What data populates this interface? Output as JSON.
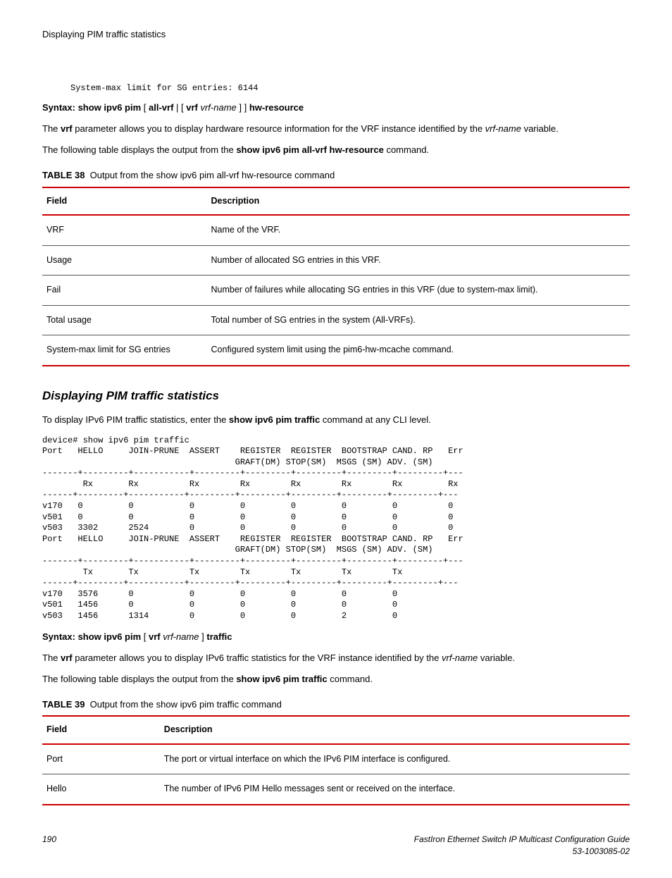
{
  "header": {
    "title": "Displaying PIM traffic statistics"
  },
  "codeblock1": "System-max limit for SG entries: 6144",
  "syntax1": {
    "prefix": "Syntax: show ipv6 pim",
    "open": " [ ",
    "allvrf": "all-vrf",
    "pipe": " | [ ",
    "vrf": "vrf",
    "vrfname": " vrf-name",
    "close": " ] ] ",
    "hw": "hw-resource"
  },
  "para1_a": "The ",
  "para1_b": "vrf",
  "para1_c": " parameter allows you to display hardware resource information for the VRF instance identified by the ",
  "para1_d": "vrf-name",
  "para1_e": " variable.",
  "para2_a": "The following table displays the output from the ",
  "para2_b": "show ipv6 pim all-vrf hw-resource",
  "para2_c": " command.",
  "table38": {
    "label": "TABLE 38",
    "title": "Output from the show ipv6 pim all-vrf hw-resource command",
    "h1": "Field",
    "h2": "Description",
    "rows": [
      {
        "f": "VRF",
        "d": "Name of the VRF."
      },
      {
        "f": "Usage",
        "d": "Number of allocated SG entries in this VRF."
      },
      {
        "f": "Fail",
        "d": "Number of failures while allocating SG entries in this VRF (due to system-max limit)."
      },
      {
        "f": "Total usage",
        "d": "Total number of SG entries in the system (All-VRFs)."
      },
      {
        "f": "System-max limit for SG entries",
        "d": "Configured system limit using the pim6-hw-mcache command."
      }
    ]
  },
  "section2": "Displaying PIM traffic statistics",
  "para3_a": "To display IPv6 PIM traffic statistics, enter the ",
  "para3_b": "show ipv6 pim traffic",
  "para3_c": " command at any CLI level.",
  "codeblock2": "device# show ipv6 pim traffic\nPort   HELLO     JOIN-PRUNE  ASSERT    REGISTER  REGISTER  BOOTSTRAP CAND. RP   Err\n                                      GRAFT(DM) STOP(SM)  MSGS (SM) ADV. (SM)\n-------+---------+-----------+---------+---------+---------+---------+---------+---\n        Rx       Rx          Rx        Rx        Rx        Rx        Rx         Rx\n------+---------+-----------+---------+---------+---------+---------+---------+---\nv170   0         0           0         0         0         0         0          0\nv501   0         0           0         0         0         0         0          0\nv503   3302      2524        0         0         0         0         0          0\nPort   HELLO     JOIN-PRUNE  ASSERT    REGISTER  REGISTER  BOOTSTRAP CAND. RP   Err\n                                      GRAFT(DM) STOP(SM)  MSGS (SM) ADV. (SM)\n-------+---------+-----------+---------+---------+---------+---------+---------+---\n        Tx       Tx          Tx        Tx        Tx        Tx        Tx\n------+---------+-----------+---------+---------+---------+---------+---------+---\nv170   3576      0           0         0         0         0         0\nv501   1456      0           0         0         0         0         0\nv503   1456      1314        0         0         0         2         0",
  "syntax2": {
    "prefix": "Syntax: show ipv6 pim",
    "open": " [ ",
    "vrf": "vrf",
    "vrfname": " vrf-name",
    "close": " ] ",
    "traffic": "traffic"
  },
  "para4_a": "The ",
  "para4_b": "vrf",
  "para4_c": " parameter allows you to display IPv6 traffic statistics for the VRF instance identified by the ",
  "para4_d": "vrf-name",
  "para4_e": " variable.",
  "para5_a": "The following table displays the output from the ",
  "para5_b": "show ipv6 pim traffic",
  "para5_c": " command.",
  "table39": {
    "label": "TABLE 39",
    "title": "Output from the show ipv6 pim traffic command",
    "h1": "Field",
    "h2": "Description",
    "rows": [
      {
        "f": "Port",
        "d": "The port or virtual interface on which the IPv6 PIM interface is configured."
      },
      {
        "f": "Hello",
        "d": "The number of IPv6 PIM Hello messages sent or received on the interface."
      }
    ]
  },
  "footer": {
    "page": "190",
    "line1": "FastIron Ethernet Switch IP Multicast Configuration Guide",
    "line2": "53-1003085-02"
  }
}
